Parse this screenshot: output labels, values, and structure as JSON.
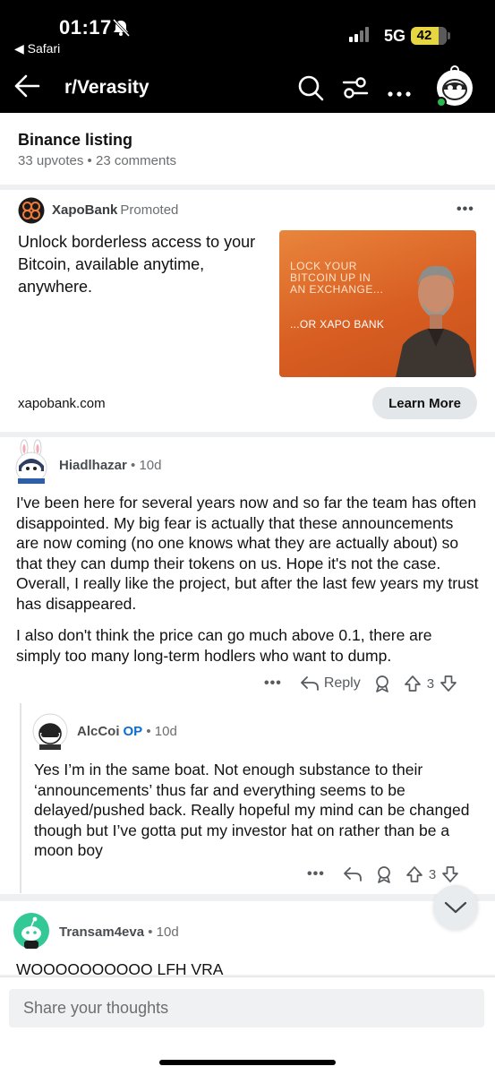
{
  "status_bar": {
    "time": "01:17",
    "back_app": "◀ Safari",
    "network": "5G",
    "battery": "42"
  },
  "nav": {
    "subreddit": "r/Verasity",
    "icons": [
      "back-arrow-icon",
      "search-icon",
      "filter-icon",
      "more-icon",
      "avatar"
    ]
  },
  "post": {
    "title": "Binance listing",
    "meta": "33 upvotes • 23 comments"
  },
  "ad": {
    "advertiser": "XapoBank",
    "label": "Promoted",
    "more": "•••",
    "text": "Unlock borderless access to your Bitcoin, available anytime, anywhere.",
    "image_line1": "LOCK YOUR",
    "image_line2": "BITCOIN UP IN",
    "image_line3": "AN EXCHANGE...",
    "image_line4": "...OR XAPO BANK",
    "domain": "xapobank.com",
    "cta": "Learn More",
    "colors": {
      "image_bg": "#d85e22"
    }
  },
  "comments": [
    {
      "user": "Hiadlhazar",
      "age": "• 10d",
      "paragraph1": "I've been here for several years now and so far the team has often disappointed. My big fear is actually that these announcements are now coming (no one knows what they are actually about) so that they can dump their tokens on us. Hope it's not the case. Overall, I really like the project, but after the last few years my trust has disappeared.",
      "paragraph2": "I also don't think the price can go much above 0.1, there are simply too many long-term hodlers who want to dump.",
      "more": "•••",
      "reply": "Reply",
      "score": "3"
    },
    {
      "user": "AlcCoi",
      "op": "OP",
      "age": "• 10d",
      "paragraph1": "Yes I’m in the same boat. Not enough substance to their ‘announcements’ thus far and everything seems to be delayed/pushed back. Really hopeful my mind can be changed though but I’ve gotta put my investor hat on rather than be a moon boy",
      "more": "•••",
      "score": "3"
    },
    {
      "user": "Transam4eva",
      "age": "• 10d",
      "paragraph1": "WOOOOOOOOOO LFH VRA"
    }
  ],
  "composer": {
    "placeholder": "Share your thoughts"
  },
  "colors": {
    "op": "#0a6fd1",
    "battery": "#e6d641",
    "header_bg": "#000000"
  }
}
